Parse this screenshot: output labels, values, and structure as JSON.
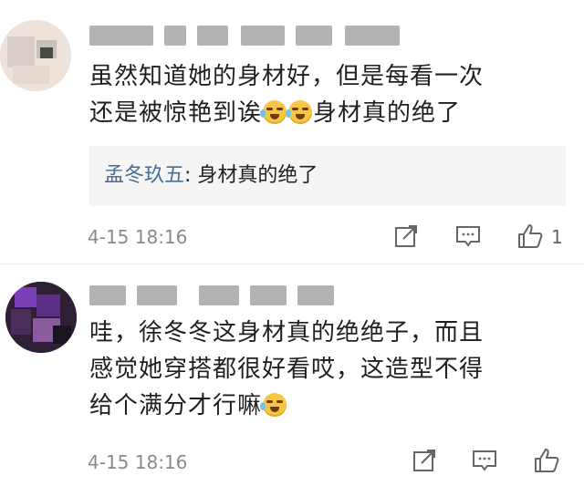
{
  "comments": [
    {
      "text": "虽然知道她的身材好，但是每看一次\n还是被惊艳到诶",
      "text_after_emoji": "身材真的绝了",
      "quote": {
        "name": "孟冬玖五",
        "separator": ":",
        "text": " 身材真的绝了"
      },
      "time": "4-15 18:16",
      "likes": "1",
      "icons": [
        "share-icon",
        "reply-icon",
        "like-icon"
      ]
    },
    {
      "text": "哇，徐冬冬这身材真的绝绝子，而且\n感觉她穿搭都很好看哎，这造型不得\n给个满分才行嘛",
      "time": "4-15 18:16",
      "icons": [
        "share-icon",
        "reply-icon",
        "like-icon"
      ]
    }
  ],
  "colors": {
    "quote_name": "#4a6d95",
    "time": "#8a8a8a",
    "quote_bg": "#f5f5f5"
  }
}
